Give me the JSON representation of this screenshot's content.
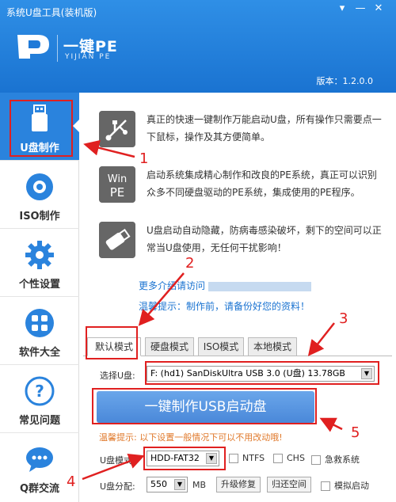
{
  "window": {
    "title": "系统U盘工具(装机版)",
    "menu_glyph": "▾",
    "minimize_glyph": "—",
    "close_glyph": "✕"
  },
  "brand": {
    "name": "一键PE",
    "sub": "YIJIAN PE"
  },
  "version": "版本：1.2.0.0",
  "sidebar": {
    "items": [
      {
        "label": "U盘制作",
        "icon": "usb-drive-icon"
      },
      {
        "label": "ISO制作",
        "icon": "disc-icon"
      },
      {
        "label": "个性设置",
        "icon": "gear-icon"
      },
      {
        "label": "软件大全",
        "icon": "apps-grid-icon"
      },
      {
        "label": "常见问题",
        "icon": "question-icon"
      },
      {
        "label": "Q群交流",
        "icon": "chat-bubble-icon"
      }
    ]
  },
  "features": [
    {
      "icon": "usb-symbol-icon",
      "text": "真正的快速一键制作万能启动U盘，所有操作只需要点一下鼠标，操作及其方便简单。"
    },
    {
      "icon": "win-pe-icon",
      "text": "启动系统集成精心制作和改良的PE系统，真正可以识别众多不同硬盘驱动的PE系统，集成使用的PE程序。"
    },
    {
      "icon": "usb-stick-icon",
      "text": "U盘启动自动隐藏，防病毒感染破坏，剩下的空间可以正常当U盘使用，无任何干扰影响！"
    }
  ],
  "more_info": "更多介绍请访问",
  "reminder": "温馨提示：制作前，请备份好您的资料！",
  "tabs": [
    "默认模式",
    "硬盘模式",
    "ISO模式",
    "本地模式"
  ],
  "form": {
    "select_usb_label": "选择U盘:",
    "select_usb_value": "F: (hd1) SanDiskUltra USB 3.0 (U盘) 13.78GB",
    "make_button": "一键制作USB启动盘",
    "warning": "温馨提示: 以下设置一般情况下可以不用改动哦!",
    "mode_label": "U盘模式:",
    "mode_value": "HDD-FAT32",
    "ntfs": "NTFS",
    "chs": "CHS",
    "emergency": "急救系统",
    "alloc_label": "U盘分配:",
    "alloc_value": "550",
    "alloc_unit": "MB",
    "upgrade_repair": "升级修复",
    "restore_space": "归还空间",
    "simulate_boot": "模拟启动"
  },
  "annotations": [
    "1",
    "2",
    "3",
    "4",
    "5"
  ],
  "colors": {
    "header_blue": "#1a73d1",
    "active_blue": "#2a83dd",
    "annotation_red": "#e02020",
    "warning_orange": "#e0792b"
  }
}
